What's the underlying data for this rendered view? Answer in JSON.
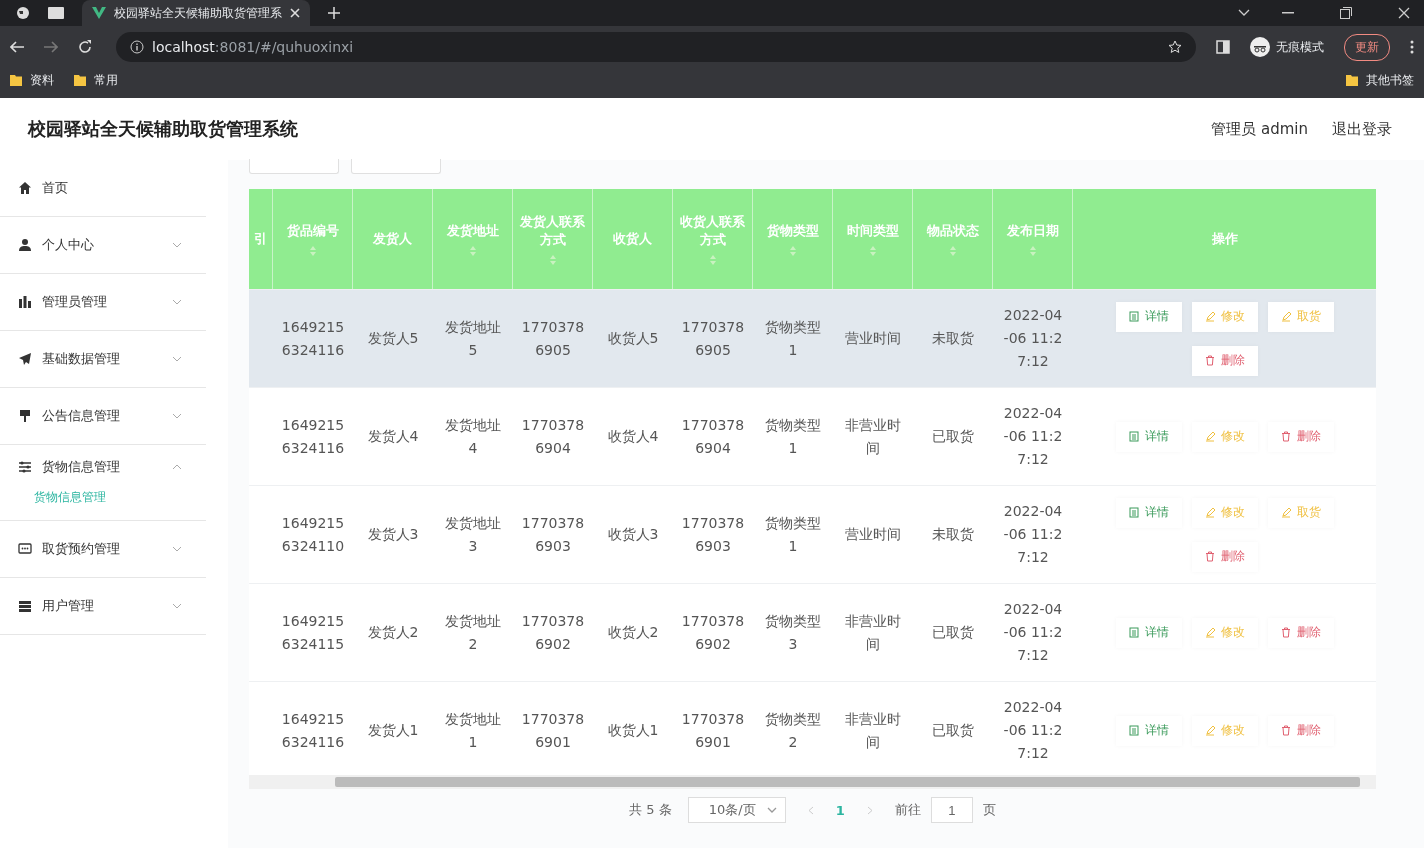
{
  "browser": {
    "tab_title": "校园驿站全天候辅助取货管理系",
    "url_host": "localhost",
    "url_rest": ":8081/#/quhuoxinxi",
    "profile_label": "无痕模式",
    "update_button": "更新",
    "bookmarks": [
      "资料",
      "常用"
    ],
    "other_bookmarks": "其他书签"
  },
  "header": {
    "title": "校园驿站全天候辅助取货管理系统",
    "user": "管理员 admin",
    "logout": "退出登录"
  },
  "sidebar": {
    "items": [
      {
        "label": "首页"
      },
      {
        "label": "个人中心",
        "expanded": false
      },
      {
        "label": "管理员管理",
        "expanded": false
      },
      {
        "label": "基础数据管理",
        "expanded": false
      },
      {
        "label": "公告信息管理",
        "expanded": false
      },
      {
        "label": "货物信息管理",
        "expanded": true,
        "children": [
          {
            "label": "货物信息管理",
            "selected": true
          }
        ]
      },
      {
        "label": "取货预约管理",
        "expanded": false
      },
      {
        "label": "用户管理",
        "expanded": false
      }
    ]
  },
  "table": {
    "cut_column": "引",
    "columns": [
      {
        "label": "货品编号",
        "sortable": true
      },
      {
        "label": "发货人",
        "sortable": false
      },
      {
        "label": "发货地址",
        "sortable": true
      },
      {
        "label": "发货人联系方式",
        "sortable": true
      },
      {
        "label": "收货人",
        "sortable": false
      },
      {
        "label": "收货人联系方式",
        "sortable": true
      },
      {
        "label": "货物类型",
        "sortable": true
      },
      {
        "label": "时间类型",
        "sortable": true
      },
      {
        "label": "物品状态",
        "sortable": true
      },
      {
        "label": "发布日期",
        "sortable": true
      },
      {
        "label": "操作",
        "sortable": false
      }
    ],
    "rows": [
      {
        "highlighted": true,
        "cells": [
          "16492156324116",
          "发货人5",
          "发货地址5",
          "17703786905",
          "收货人5",
          "17703786905",
          "货物类型1",
          "营业时间",
          "未取货",
          "2022-04-06 11:27:12"
        ],
        "actions": [
          {
            "label": "详情",
            "kind": "detail"
          },
          {
            "label": "修改",
            "kind": "edit"
          },
          {
            "label": "取货",
            "kind": "pickup"
          },
          {
            "label": "删除",
            "kind": "delete"
          }
        ]
      },
      {
        "highlighted": false,
        "cells": [
          "16492156324116",
          "发货人4",
          "发货地址4",
          "17703786904",
          "收货人4",
          "17703786904",
          "货物类型1",
          "非营业时间",
          "已取货",
          "2022-04-06 11:27:12"
        ],
        "actions": [
          {
            "label": "详情",
            "kind": "detail"
          },
          {
            "label": "修改",
            "kind": "edit"
          },
          {
            "label": "删除",
            "kind": "delete"
          }
        ]
      },
      {
        "highlighted": false,
        "cells": [
          "16492156324110",
          "发货人3",
          "发货地址3",
          "17703786903",
          "收货人3",
          "17703786903",
          "货物类型1",
          "营业时间",
          "未取货",
          "2022-04-06 11:27:12"
        ],
        "actions": [
          {
            "label": "详情",
            "kind": "detail"
          },
          {
            "label": "修改",
            "kind": "edit"
          },
          {
            "label": "取货",
            "kind": "pickup"
          },
          {
            "label": "删除",
            "kind": "delete"
          }
        ]
      },
      {
        "highlighted": false,
        "cells": [
          "16492156324115",
          "发货人2",
          "发货地址2",
          "17703786902",
          "收货人2",
          "17703786902",
          "货物类型3",
          "非营业时间",
          "已取货",
          "2022-04-06 11:27:12"
        ],
        "actions": [
          {
            "label": "详情",
            "kind": "detail"
          },
          {
            "label": "修改",
            "kind": "edit"
          },
          {
            "label": "删除",
            "kind": "delete"
          }
        ]
      },
      {
        "highlighted": false,
        "cells": [
          "16492156324116",
          "发货人1",
          "发货地址1",
          "17703786901",
          "收货人1",
          "17703786901",
          "货物类型2",
          "非营业时间",
          "已取货",
          "2022-04-06 11:27:12"
        ],
        "actions": [
          {
            "label": "详情",
            "kind": "detail"
          },
          {
            "label": "修改",
            "kind": "edit"
          },
          {
            "label": "删除",
            "kind": "delete"
          }
        ]
      }
    ]
  },
  "pagination": {
    "total": "共 5 条",
    "page_size": "10条/页",
    "pages": [
      {
        "label": "1",
        "selected": true
      }
    ],
    "goto_label": "前往",
    "goto_value": "1",
    "goto_suffix": "页"
  }
}
